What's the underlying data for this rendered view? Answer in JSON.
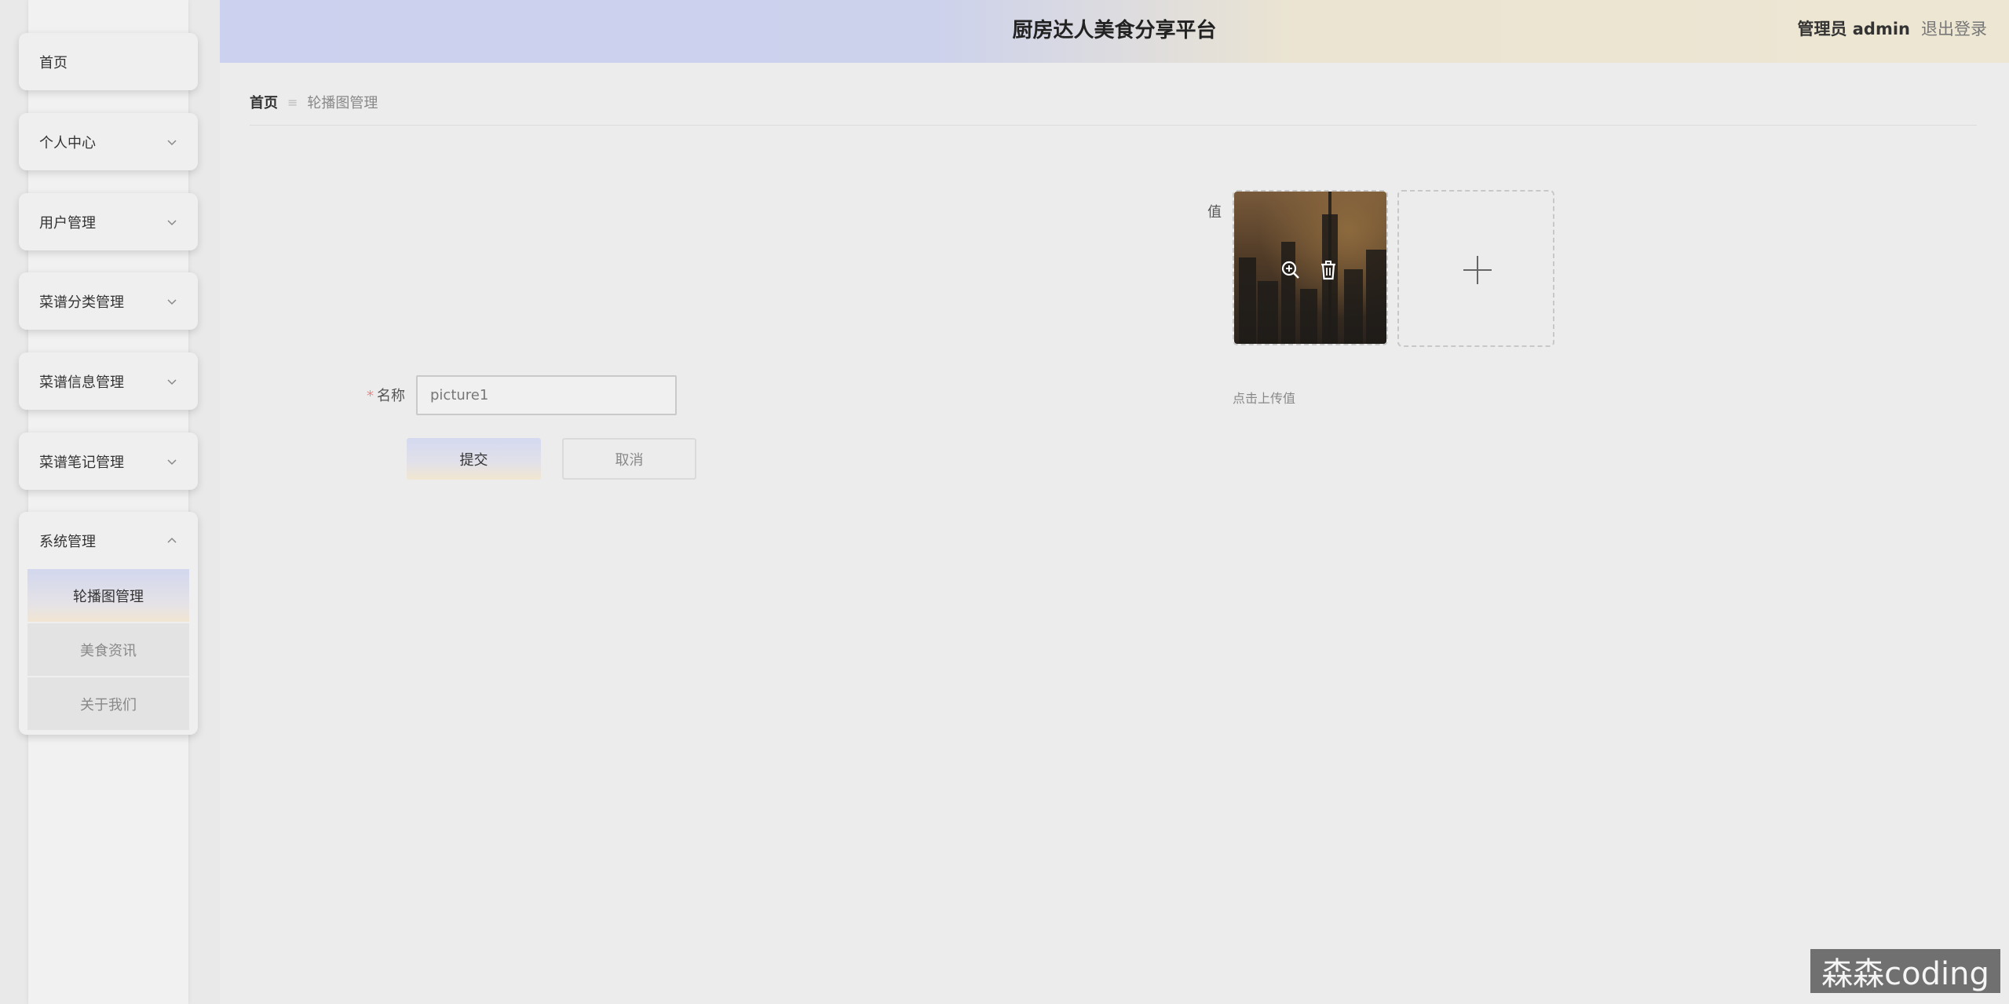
{
  "header": {
    "title": "厨房达人美食分享平台",
    "user_label": "管理员 admin",
    "logout_label": "退出登录"
  },
  "sidebar": {
    "items": [
      {
        "label": "首页"
      },
      {
        "label": "个人中心"
      },
      {
        "label": "用户管理"
      },
      {
        "label": "菜谱分类管理"
      },
      {
        "label": "菜谱信息管理"
      },
      {
        "label": "菜谱笔记管理"
      }
    ],
    "group": {
      "label": "系统管理",
      "expanded": true,
      "children": [
        {
          "label": "轮播图管理",
          "active": true
        },
        {
          "label": "美食资讯"
        },
        {
          "label": "关于我们"
        }
      ]
    }
  },
  "breadcrumb": {
    "home": "首页",
    "current": "轮播图管理"
  },
  "form": {
    "value_label": "值",
    "upload_tip": "点击上传值",
    "thumb_actions": [
      "zoom-in-icon",
      "delete-icon"
    ],
    "name_required_mark": "*",
    "name_label": "名称",
    "name_value": "picture1",
    "submit_label": "提交",
    "cancel_label": "取消"
  },
  "watermark": "森森coding"
}
